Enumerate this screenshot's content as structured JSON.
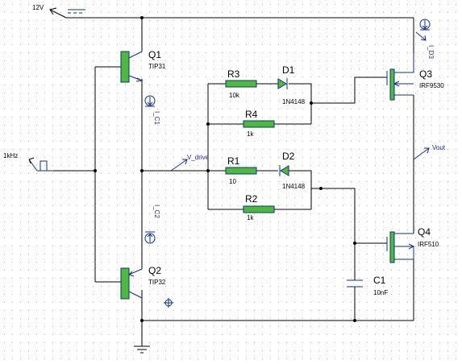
{
  "colors": {
    "wire": "#000000",
    "component_outline": "#0b2f8a",
    "component_fill": "#4dbb3a",
    "net_label": "#1f1f9f",
    "grid_dot": "#b8b8b8"
  },
  "supply": {
    "label": "12V"
  },
  "source": {
    "label": "1kHz"
  },
  "nets": {
    "drive": "V_drive",
    "out": "Vout"
  },
  "components": {
    "q1": {
      "ref": "Q1",
      "value": "TIP31"
    },
    "q2": {
      "ref": "Q2",
      "value": "TIP32"
    },
    "q3": {
      "ref": "Q3",
      "value": "IRF9530"
    },
    "q4": {
      "ref": "Q4",
      "value": "IRF510"
    },
    "r1": {
      "ref": "R1",
      "value": "10"
    },
    "r2": {
      "ref": "R2",
      "value": "1k"
    },
    "r3": {
      "ref": "R3",
      "value": "10k"
    },
    "r4": {
      "ref": "R4",
      "value": "1k"
    },
    "d1": {
      "ref": "D1",
      "value": "1N4148"
    },
    "d2": {
      "ref": "D2",
      "value": "1N4148"
    },
    "c1": {
      "ref": "C1",
      "value": "10nF"
    }
  },
  "probes": {
    "ic1": "I_C1",
    "ic2": "I_C2",
    "id3": "I_D3"
  },
  "icons": [
    "ground-icon",
    "current-probe-icon",
    "square-wave-source-icon",
    "supply-arrow-icon",
    "voltage-arrow-icon",
    "crosshair-icon"
  ]
}
